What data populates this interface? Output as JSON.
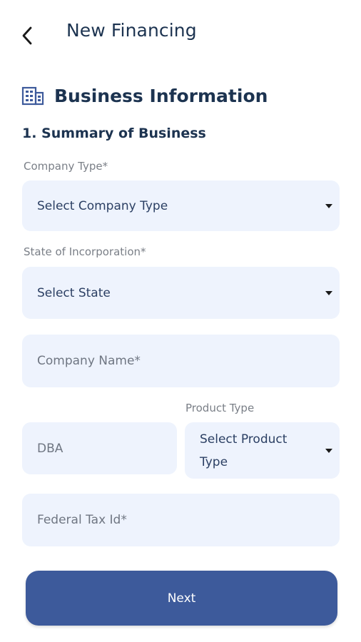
{
  "header": {
    "title": "New Financing",
    "back_icon": "chevron-left-icon"
  },
  "section": {
    "title": "Business Information",
    "icon": "building-icon"
  },
  "subsection": {
    "title": "1. Summary of Business"
  },
  "form": {
    "company_type": {
      "label": "Company Type*",
      "value": "Select Company Type"
    },
    "state": {
      "label": "State of Incorporation*",
      "value": "Select State"
    },
    "company_name": {
      "placeholder": "Company Name*"
    },
    "dba": {
      "placeholder": "DBA"
    },
    "product_type": {
      "label": "Product Type",
      "value": "Select Product Type"
    },
    "federal_tax_id": {
      "placeholder": "Federal Tax Id*"
    }
  },
  "actions": {
    "next_label": "Next"
  },
  "colors": {
    "primary": "#3d5a9b",
    "text_dark": "#1c3350",
    "field_bg": "#eef3fd",
    "label_gray": "#7a7f87"
  }
}
